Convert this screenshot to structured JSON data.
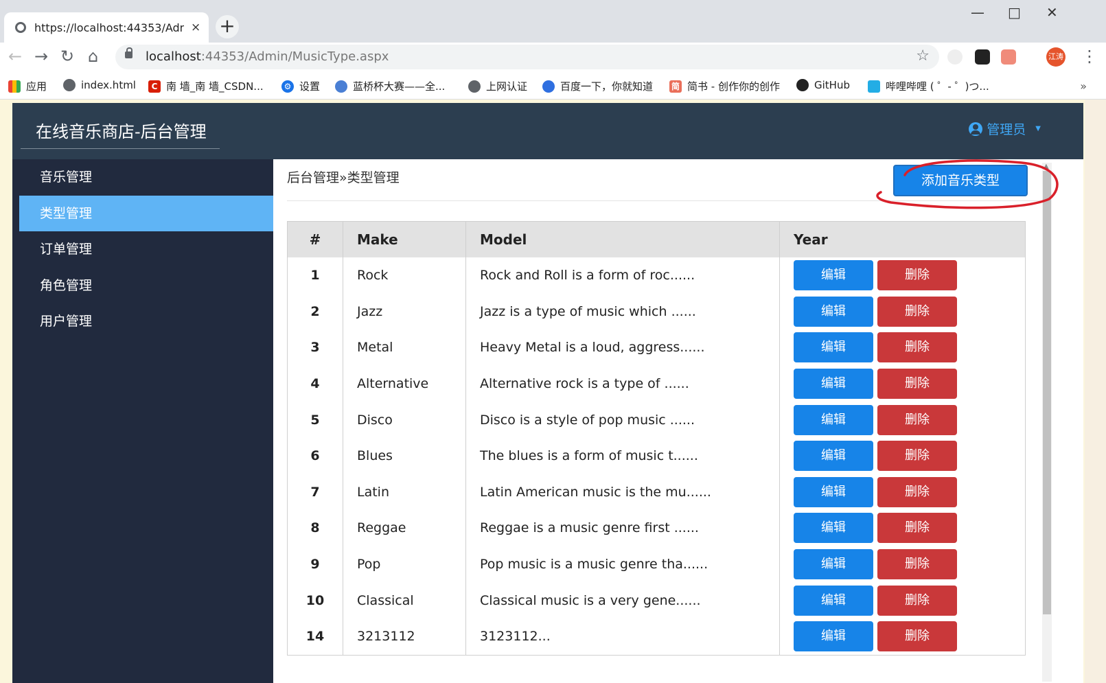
{
  "browser": {
    "tab_title": "https://localhost:44353/Admin",
    "tab_close": "×",
    "new_tab": "+",
    "url_host": "localhost",
    "url_rest": ":44353/Admin/MusicType.aspx",
    "avatar_text": "江涛",
    "bookmarks": [
      {
        "label": "应用"
      },
      {
        "label": "index.html"
      },
      {
        "label": "南 墙_南 墙_CSDN..."
      },
      {
        "label": "设置"
      },
      {
        "label": "蓝桥杯大赛——全..."
      },
      {
        "label": "上网认证"
      },
      {
        "label": "百度一下，你就知道"
      },
      {
        "label": "简书 - 创作你的创作"
      },
      {
        "label": "GitHub"
      },
      {
        "label": "哔哩哔哩 ( ゜- ゜)つ..."
      }
    ],
    "bookmarks_more": "»"
  },
  "app": {
    "brand": "在线音乐商店-后台管理",
    "user_label": "管理员",
    "sidebar": [
      {
        "label": "音乐管理",
        "active": false
      },
      {
        "label": "类型管理",
        "active": true
      },
      {
        "label": "订单管理",
        "active": false
      },
      {
        "label": "角色管理",
        "active": false
      },
      {
        "label": "用户管理",
        "active": false
      }
    ],
    "breadcrumb": "后台管理»类型管理",
    "add_button": "添加音乐类型",
    "table": {
      "headers": [
        "#",
        "Make",
        "Model",
        "Year"
      ],
      "edit_label": "编辑",
      "delete_label": "删除",
      "rows": [
        {
          "id": "1",
          "make": "Rock",
          "model": "Rock and Roll is a form of roc......"
        },
        {
          "id": "2",
          "make": "Jazz",
          "model": "Jazz is a type of music which ......"
        },
        {
          "id": "3",
          "make": "Metal",
          "model": "Heavy Metal is a loud, aggress......"
        },
        {
          "id": "4",
          "make": "Alternative",
          "model": "Alternative rock is a type of ......"
        },
        {
          "id": "5",
          "make": "Disco",
          "model": "Disco is a style of pop music ......"
        },
        {
          "id": "6",
          "make": "Blues",
          "model": "The blues is a form of music t......"
        },
        {
          "id": "7",
          "make": "Latin",
          "model": "Latin American music is the mu......"
        },
        {
          "id": "8",
          "make": "Reggae",
          "model": "Reggae is a music genre first ......"
        },
        {
          "id": "9",
          "make": "Pop",
          "model": "Pop music is a music genre tha......"
        },
        {
          "id": "10",
          "make": "Classical",
          "model": "Classical music is a very gene......"
        },
        {
          "id": "14",
          "make": "3213112",
          "model": "3123112..."
        }
      ]
    }
  },
  "colors": {
    "header_bg": "#2c3e50",
    "sidebar_bg": "#212a3e",
    "active_item": "#5fb4f5",
    "primary": "#1784e8",
    "danger": "#c9383a",
    "annotation": "#d9202a"
  }
}
